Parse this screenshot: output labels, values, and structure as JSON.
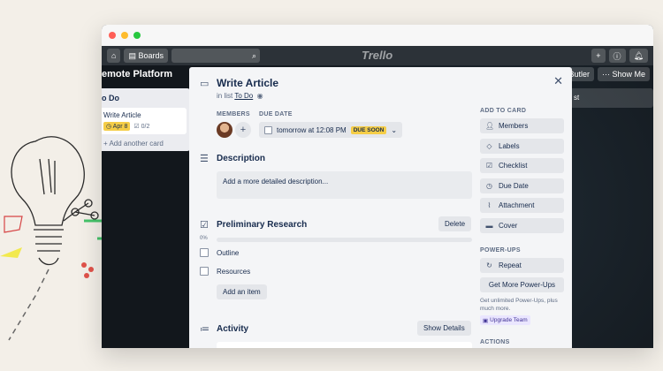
{
  "board": {
    "nav_boards": "Boards",
    "logo": "Trello",
    "title": "emote Platform",
    "butler": "Butler",
    "show_menu": "Show Me",
    "right_list_label": "st",
    "list_title": "o Do",
    "mini_card_title": "Write Article",
    "mini_card_date": "Apr 8",
    "mini_card_checks": "0/2",
    "add_another_card": "+ Add another card"
  },
  "card": {
    "title": "Write Article",
    "in_list_prefix": "in list",
    "list_name": "To Do",
    "members_label": "MEMBERS",
    "due_label": "DUE DATE",
    "due_text": "tomorrow at 12:08 PM",
    "due_badge": "DUE SOON",
    "description_title": "Description",
    "description_placeholder": "Add a more detailed description...",
    "checklist_title": "Preliminary Research",
    "delete_label": "Delete",
    "progress_percent": "0%",
    "progress_fraction": 0,
    "checklist_items": [
      "Outline",
      "Resources"
    ],
    "add_item_label": "Add an item",
    "activity_title": "Activity",
    "show_details_label": "Show Details"
  },
  "sidebar": {
    "add_to_card_label": "ADD TO CARD",
    "add_items": [
      "Members",
      "Labels",
      "Checklist",
      "Due Date",
      "Attachment",
      "Cover"
    ],
    "powerups_label": "POWER-UPS",
    "repeat_label": "Repeat",
    "get_more_label": "Get More Power-Ups",
    "note": "Get unlimited Power-Ups, plus much more.",
    "upgrade_label": "Upgrade Team",
    "actions_label": "ACTIONS"
  },
  "colors": {
    "due_soon": "#f5cd47",
    "upgrade_bg": "#eae6ff",
    "upgrade_text": "#403294"
  }
}
